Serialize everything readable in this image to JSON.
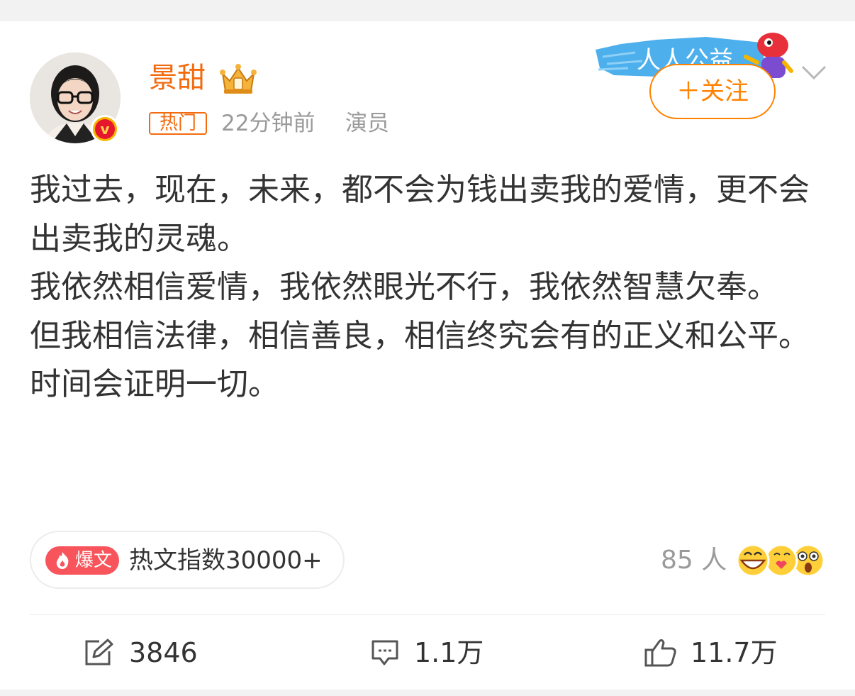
{
  "user": {
    "name": "景甜",
    "tag": "热门",
    "time": "22分钟前",
    "role": "演员",
    "verified_icon": "verified-v-icon",
    "verified_text": "v",
    "crown_icon": "crown-icon"
  },
  "banner": {
    "text": "人人公益",
    "icon": "charity-mascot-icon"
  },
  "follow_button": {
    "label": "＋关注"
  },
  "post": {
    "lines": [
      "我过去，现在，未来，都不会为钱出卖我的爱情，更不会出卖我的灵魂。",
      "我依然相信爱情，我依然眼光不行，我依然智慧欠奉。",
      "但我相信法律，相信善良，相信终究会有的正义和公平。",
      "时间会证明一切。"
    ]
  },
  "hot_article": {
    "badge_label": "爆文",
    "index_text": "热文指数30000+"
  },
  "reactions": {
    "count_text": "85 人",
    "icons": [
      "laugh-emoji-icon",
      "love-emoji-icon",
      "shocked-emoji-icon"
    ]
  },
  "actions": {
    "repost": {
      "count": "3846",
      "icon": "repost-icon"
    },
    "comment": {
      "count": "1.1万",
      "icon": "comment-icon"
    },
    "like": {
      "count": "11.7万",
      "icon": "thumbs-up-icon"
    }
  },
  "colors": {
    "username": "#f26b0f",
    "follow": "#ff8200",
    "meta": "#9a9a9a",
    "text": "#333333",
    "hot_badge": "#f7545b"
  }
}
